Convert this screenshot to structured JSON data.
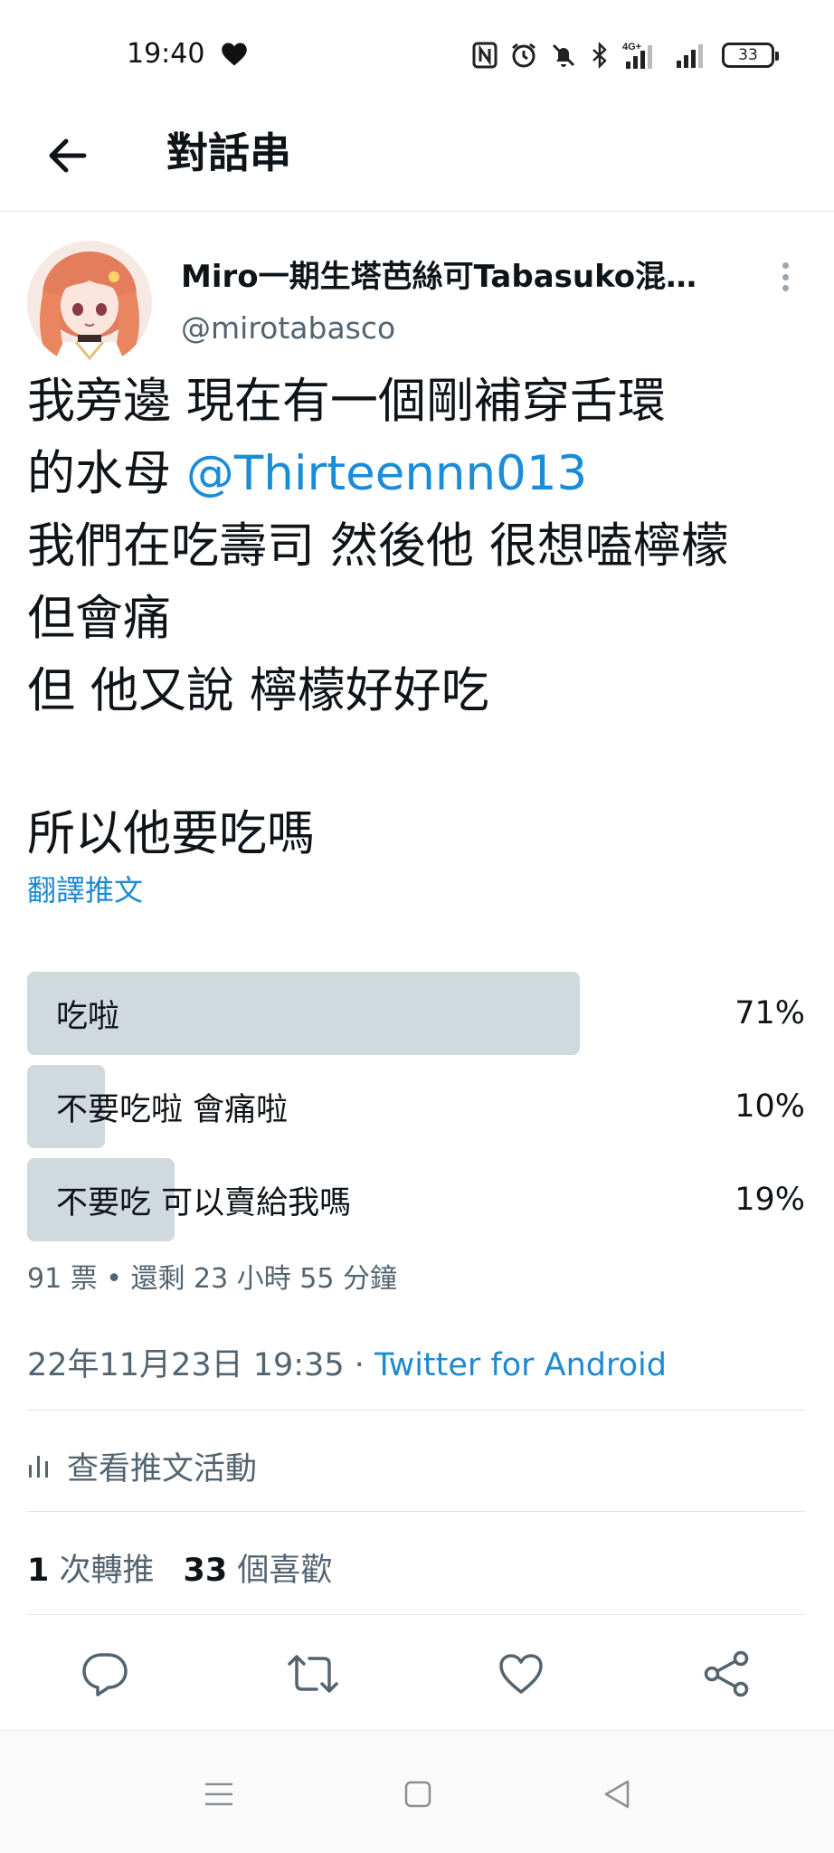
{
  "status_bar": {
    "time": "19:40",
    "battery": "33",
    "network": "4G+"
  },
  "header": {
    "title": "對話串"
  },
  "tweet": {
    "display_name": "Miro一期生塔芭絲可Tabasuko混…",
    "handle": "@mirotabasco",
    "body_lines": [
      "我旁邊 現在有一個剛補穿舌環",
      "的水母 ",
      "@Thirteennn013",
      "我們在吃壽司 然後他 很想嗑檸檬",
      "但會痛",
      "但 他又說 檸檬好好吃",
      "所以他要吃嗎"
    ],
    "translate": "翻譯推文"
  },
  "poll": {
    "options": [
      {
        "label": "吃啦",
        "percent": "71%",
        "fraction": 0.71
      },
      {
        "label": "不要吃啦 會痛啦",
        "percent": "10%",
        "fraction": 0.1
      },
      {
        "label": "不要吃 可以賣給我嗎",
        "percent": "19%",
        "fraction": 0.19
      }
    ],
    "meta": "91 票 • 還剩 23 小時 55 分鐘"
  },
  "timestamp": {
    "date": "22年11月23日 19:35 · ",
    "source": "Twitter for Android"
  },
  "activity": {
    "label": "查看推文活動"
  },
  "stats": {
    "retweets_count": "1",
    "retweets_label": " 次轉推",
    "likes_count": "33",
    "likes_label": " 個喜歡"
  },
  "colors": {
    "accent": "#1d9bf0",
    "poll_bar": "#cfd9de",
    "secondary_text": "#536471"
  },
  "icons": {
    "back": "arrow-left-icon",
    "more": "more-vertical-icon",
    "reply": "reply-icon",
    "retweet": "retweet-icon",
    "like": "heart-icon",
    "share": "share-icon"
  }
}
